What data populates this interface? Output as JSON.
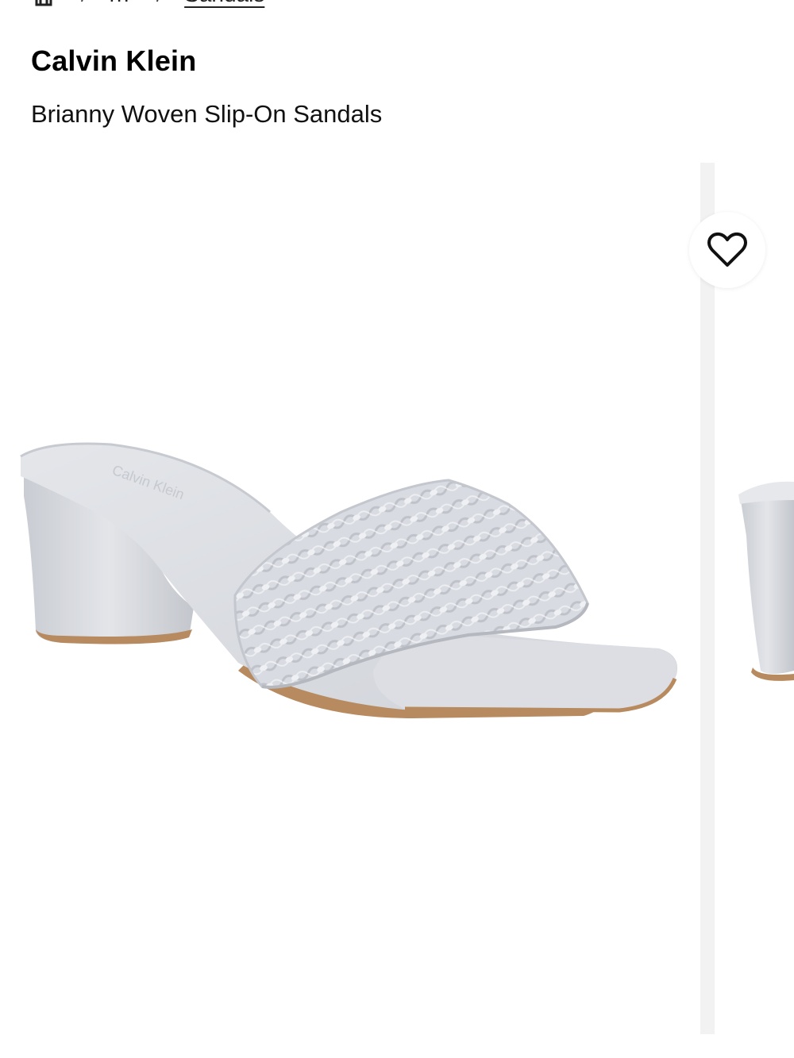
{
  "breadcrumb": {
    "home_icon": "home-icon",
    "ellipsis": "...",
    "current": "Sandals"
  },
  "product": {
    "brand": "Calvin Klein",
    "name": "Brianny Woven Slip-On Sandals"
  },
  "gallery": {
    "wishlist_icon": "heart-outline-icon",
    "image_description_color": "#d9dce2"
  },
  "colors": {
    "sandal_body": "#d5d8de",
    "sandal_shadow": "#b9bcc3",
    "sole_edge": "#b88a5f",
    "gallery_divider": "#f2f2f3"
  }
}
